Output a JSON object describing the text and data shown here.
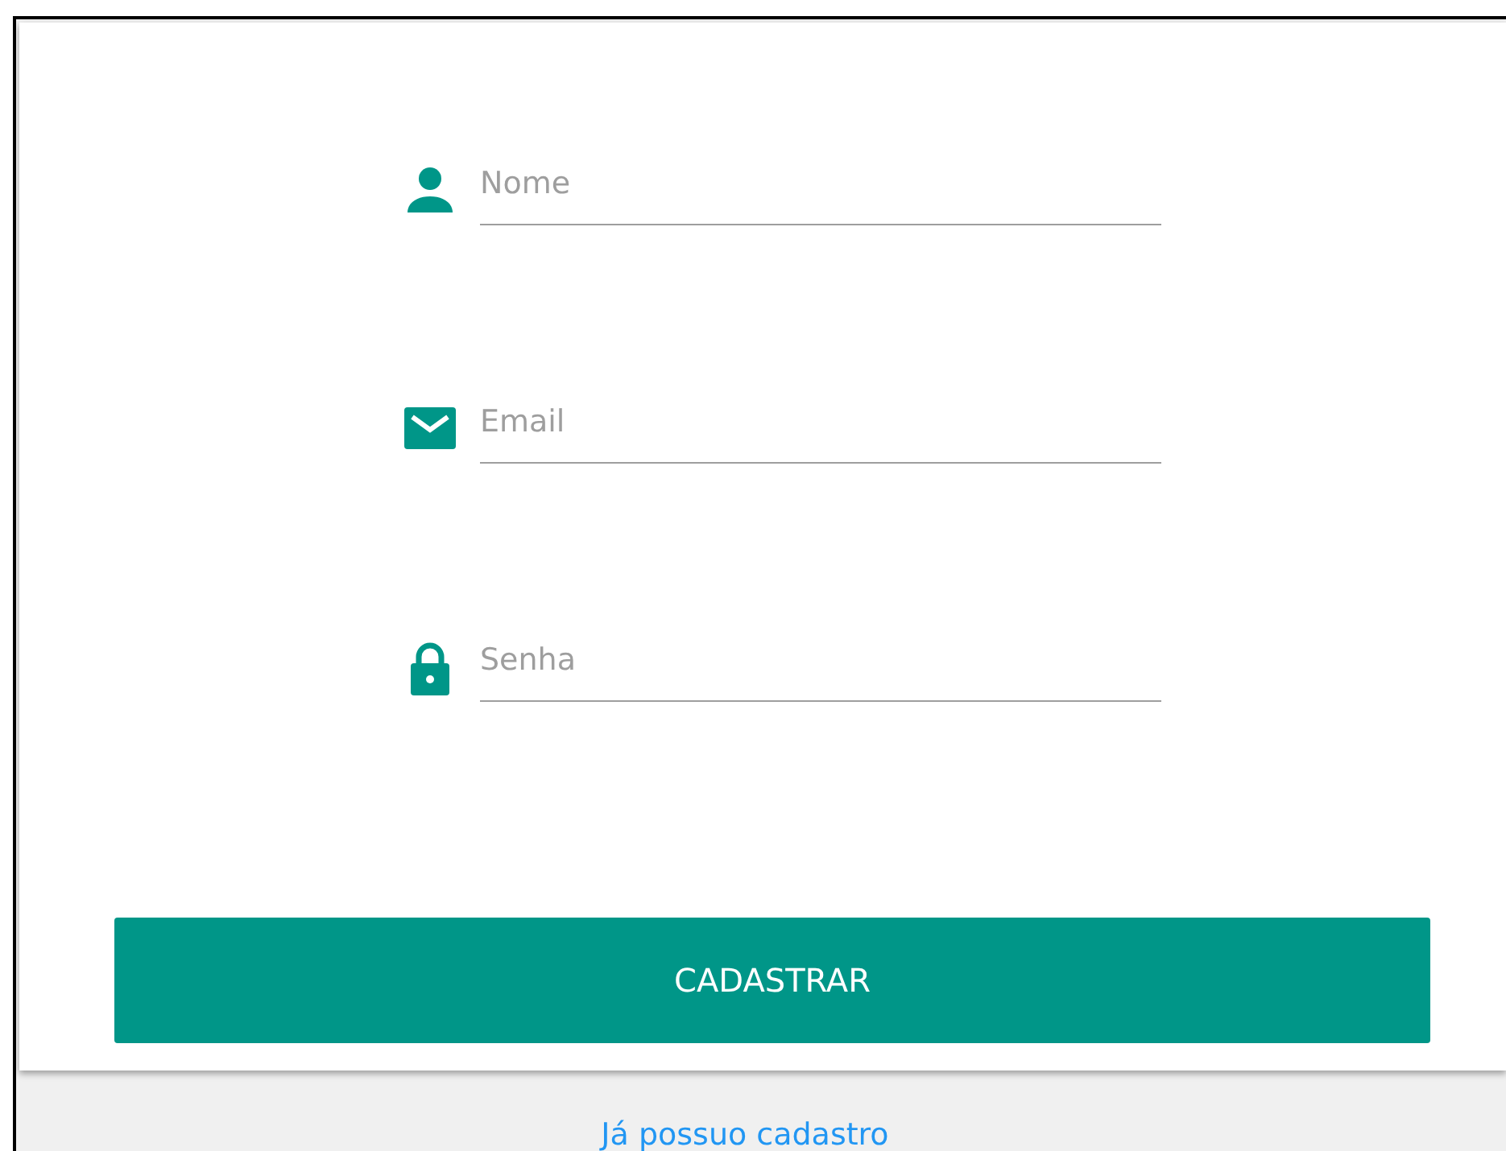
{
  "fields": [
    {
      "kind": "person",
      "placeholder": "Nome"
    },
    {
      "kind": "mail",
      "placeholder": "Email"
    },
    {
      "kind": "lock",
      "placeholder": "Senha"
    }
  ],
  "submit_button": "CADASTRAR",
  "login_link": "Já possuo cadastro"
}
